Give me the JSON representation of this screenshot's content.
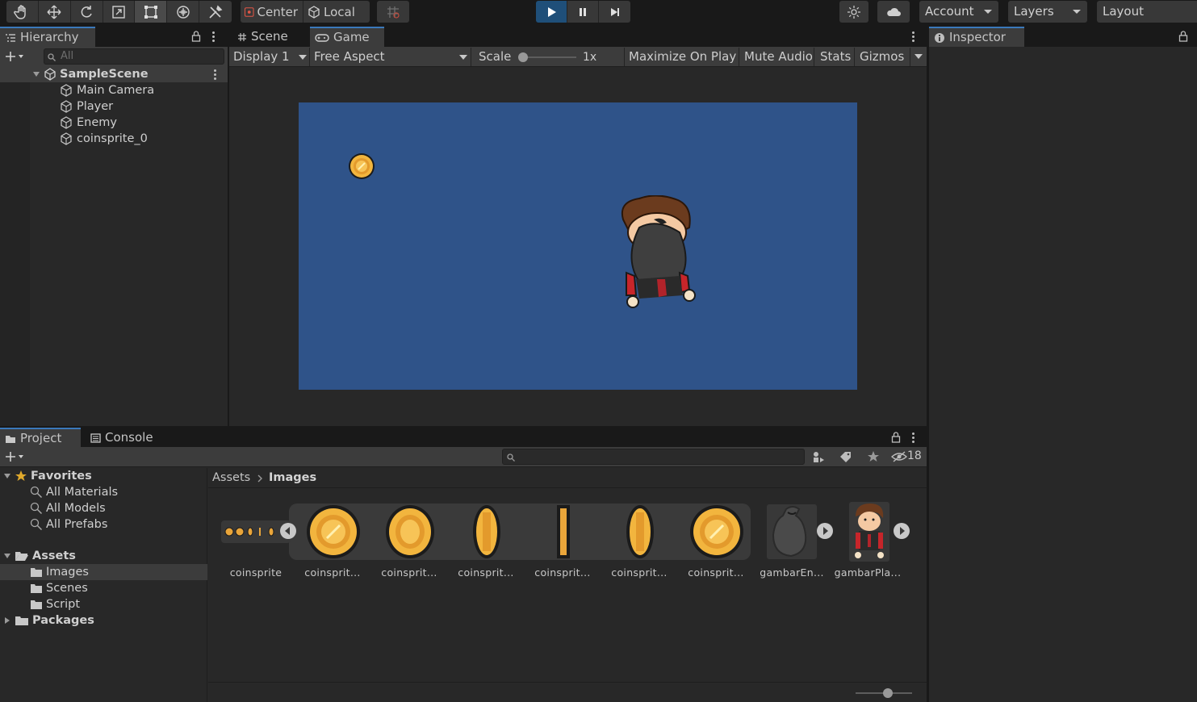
{
  "toolbar": {
    "tools": [
      "hand-tool",
      "move-tool",
      "rotate-tool",
      "scale-tool",
      "rect-tool",
      "transform-tool",
      "custom-tool"
    ],
    "pivot_center": "Center",
    "pivot_local": "Local",
    "account": "Account",
    "layers": "Layers",
    "layout": "Layout"
  },
  "hierarchy": {
    "tab_label": "Hierarchy",
    "search_placeholder": "All",
    "scene_name": "SampleScene",
    "objects": [
      "Main Camera",
      "Player",
      "Enemy",
      "coinsprite_0"
    ]
  },
  "game_view": {
    "scene_tab": "Scene",
    "game_tab": "Game",
    "display": "Display 1",
    "aspect": "Free Aspect",
    "scale_label": "Scale",
    "scale_value": "1x",
    "maximize": "Maximize On Play",
    "mute": "Mute Audio",
    "stats": "Stats",
    "gizmos": "Gizmos",
    "background_color": "#2f5389"
  },
  "inspector": {
    "tab_label": "Inspector"
  },
  "project": {
    "project_tab": "Project",
    "console_tab": "Console",
    "hidden_count": "18",
    "favorites": {
      "label": "Favorites",
      "items": [
        "All Materials",
        "All Models",
        "All Prefabs"
      ]
    },
    "assets": {
      "label": "Assets",
      "folders": [
        "Images",
        "Scenes",
        "Script"
      ]
    },
    "packages": "Packages",
    "breadcrumb": [
      "Assets",
      "Images"
    ],
    "asset_items": [
      "coinsprite",
      "coinsprit...",
      "coinsprit...",
      "coinsprit...",
      "coinsprit...",
      "coinsprit...",
      "coinsprit...",
      "gambarEn...",
      "gambarPla..."
    ]
  },
  "colors": {
    "accent": "#3a79bb",
    "play_active": "#1f4f79",
    "coin": "#e9a53a"
  }
}
